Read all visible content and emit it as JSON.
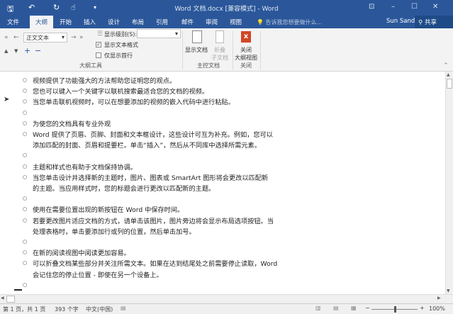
{
  "title": "Word 文档.docx [兼容模式] - Word",
  "quick_access": {
    "save": "🖫",
    "undo": "↶",
    "redo": "↻",
    "touch": "☝",
    "customize": "▾"
  },
  "window": {
    "restore_ribbon": "⊡",
    "minimize": "–",
    "maximize": "☐",
    "close": "✕"
  },
  "tabs": [
    {
      "label": "文件"
    },
    {
      "label": "大纲"
    },
    {
      "label": "开始"
    },
    {
      "label": "插入"
    },
    {
      "label": "设计"
    },
    {
      "label": "布局"
    },
    {
      "label": "引用"
    },
    {
      "label": "邮件"
    },
    {
      "label": "审阅"
    },
    {
      "label": "视图"
    }
  ],
  "tell_me": "告诉我您想要做什么...",
  "user": "Sun Sandra",
  "share": "共享",
  "ribbon": {
    "outline_tools": {
      "level_value": "正文文本",
      "show_level_label": "显示级别(S):",
      "show_level_value": "",
      "show_text_format": "显示文本格式",
      "show_text_format_checked": true,
      "show_first_line": "仅显示首行",
      "show_first_line_checked": false,
      "group_label": "大纲工具"
    },
    "master": {
      "show_document": "显示文档",
      "collapse_1": "折叠",
      "collapse_2": "子文档",
      "group_label": "主控文档"
    },
    "close": {
      "label_1": "关闭",
      "label_2": "大纲视图",
      "group_label": "关闭"
    }
  },
  "document": {
    "lines": [
      "视频提供了功能强大的方法帮助您证明您的观点。",
      "您也可以键入一个关键字以联机搜索最适合您的文档的视频。",
      "当您单击联机视频时，可以在想要添加的视频的嵌入代码中进行粘贴。",
      "",
      "为使您的文档具有专业外观",
      "Word 提供了页眉、页脚、封面和文本框设计，这些设计可互为补充。例如，您可以",
      "添加匹配的封面、页眉和提要栏。单击“插入”，然后从不同库中选择所需元素。",
      "",
      "主题和样式也有助于文档保持协调。",
      "当您单击设计并选择新的主题时，图片、图表或 SmartArt 图形将会更改以匹配新",
      "的主题。当应用样式时，您的标题会进行更改以匹配新的主题。",
      "",
      "使用在需要位置出现的新按钮在 Word 中保存时间。",
      "若要更改图片适应文档的方式，请单击该图片，图片旁边将会显示布局选项按钮。当",
      "处理表格时，单击要添加行或列的位置，然后单击加号。",
      "",
      "在新的阅读视图中阅读更加容易。",
      "可以折叠文档某些部分并关注所需文本。如果在达到结尾处之前需要停止读取，Word",
      "会记住您的停止位置 - 即使在另一个设备上。",
      ""
    ],
    "bullets": [
      true,
      true,
      true,
      true,
      true,
      true,
      false,
      true,
      true,
      true,
      false,
      true,
      true,
      true,
      false,
      true,
      true,
      true,
      false,
      true
    ]
  },
  "status": {
    "page": "第 1 页，共 1 页",
    "words": "393 个字",
    "language": "中文(中国)",
    "zoom": "100%",
    "zoom_percent": 100
  }
}
